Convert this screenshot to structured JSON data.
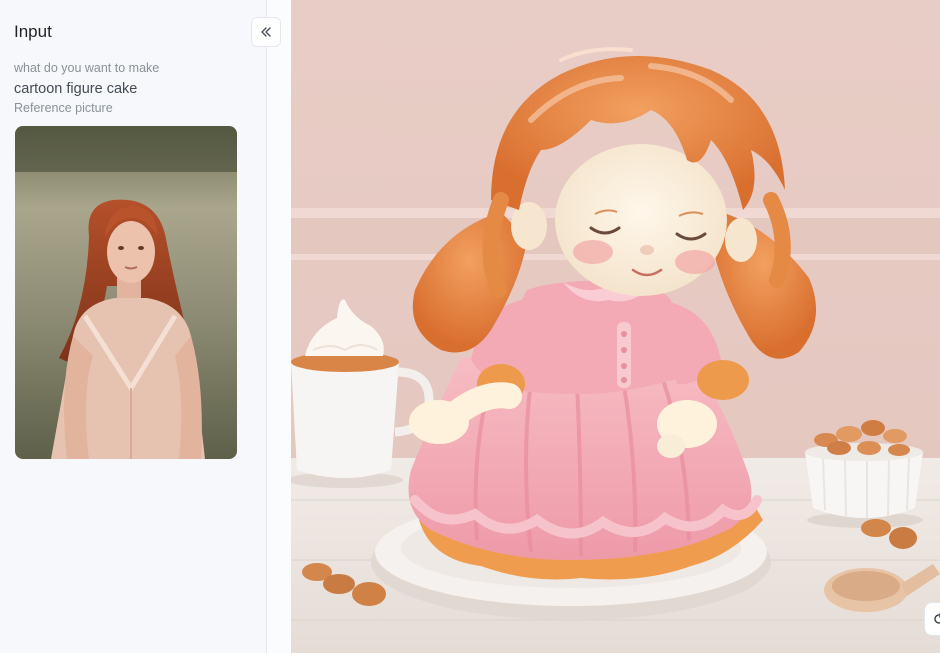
{
  "sidebar": {
    "title": "Input",
    "collapse_icon": "double-chevron-left-icon",
    "prompt_label": "what do you want to make",
    "prompt_value": "cartoon figure cake",
    "reference_label": "Reference picture"
  },
  "result": {
    "floating_icon": "refresh-icon"
  },
  "colors": {
    "sidebar_bg": "#f6f8fb",
    "wall": "#e7cbc4",
    "hair": "#e88a45",
    "dress": "#f2a9b4"
  }
}
